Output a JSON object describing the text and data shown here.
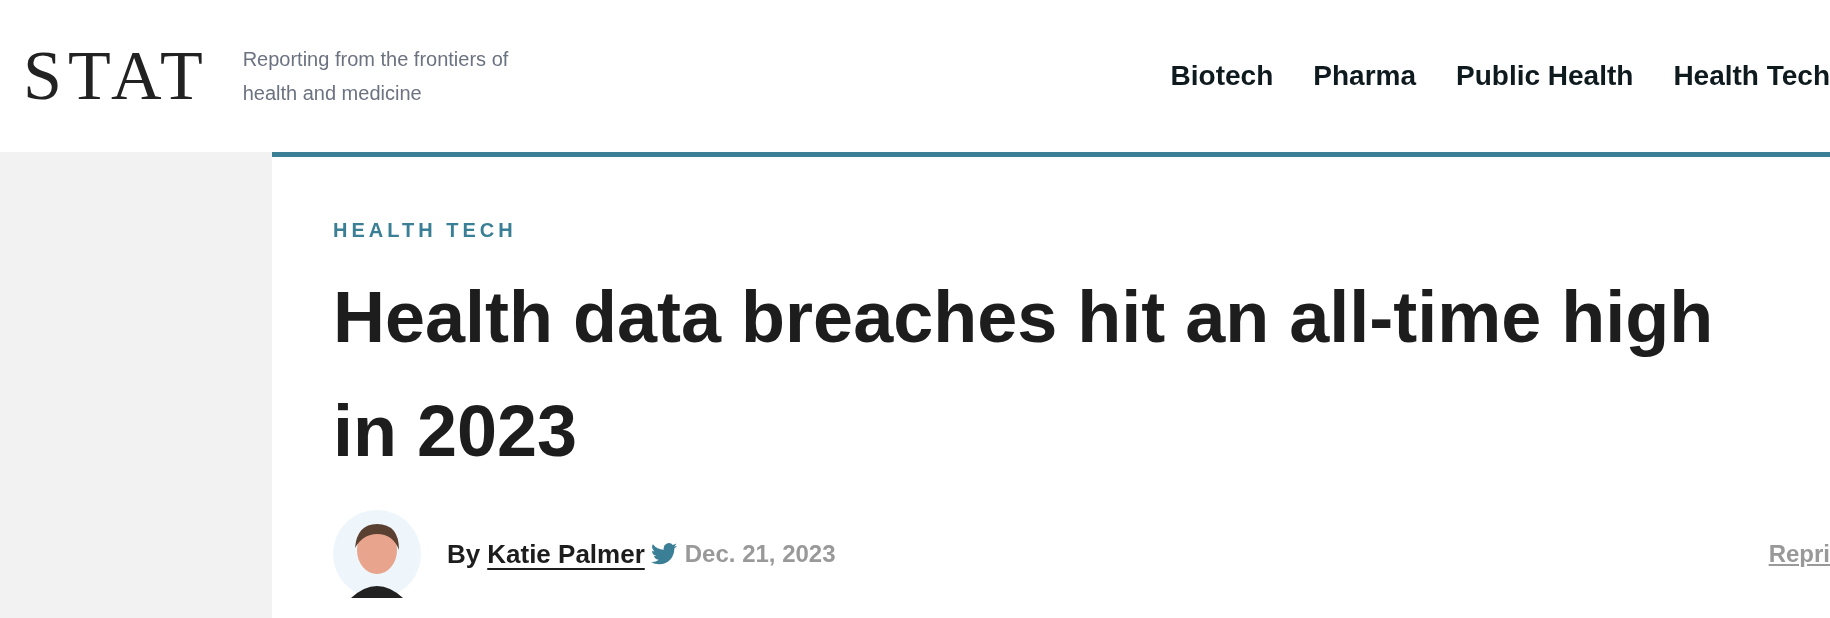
{
  "header": {
    "logo": "STAT",
    "tagline": "Reporting from the frontiers of health and medicine",
    "nav": [
      {
        "label": "Biotech"
      },
      {
        "label": "Pharma"
      },
      {
        "label": "Public Health"
      },
      {
        "label": "Health Tech"
      }
    ]
  },
  "article": {
    "category": "HEALTH TECH",
    "headline": "Health data breaches hit an all-time high in 2023",
    "byline": {
      "prefix": "By",
      "author": "Katie Palmer",
      "date": "Dec. 21, 2023"
    },
    "side_link": "Repri"
  }
}
